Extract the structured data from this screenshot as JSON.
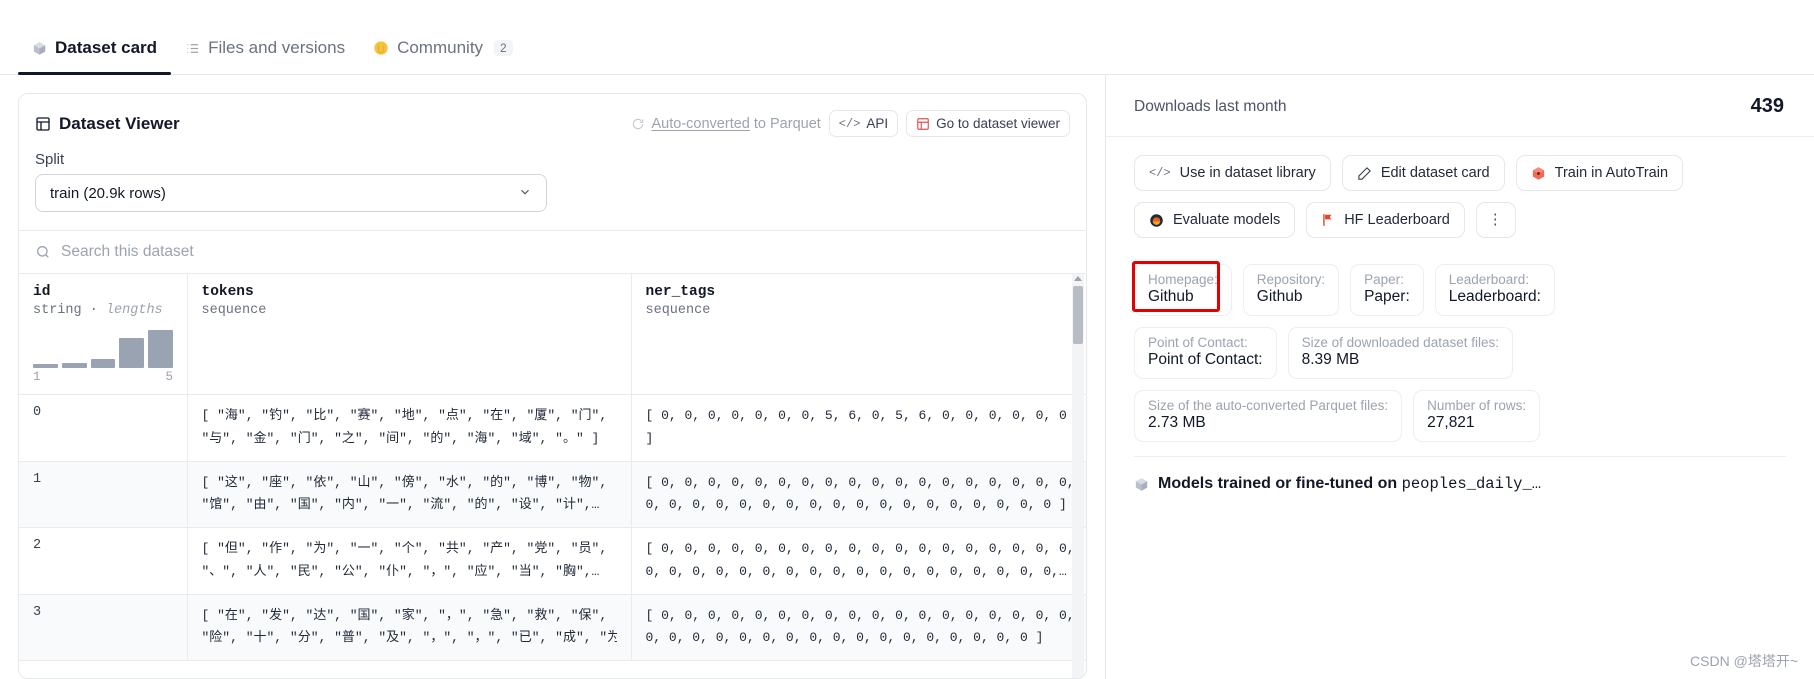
{
  "tabs": [
    {
      "label": "Dataset card",
      "icon": "cube-icon",
      "active": true,
      "badge": ""
    },
    {
      "label": "Files and versions",
      "icon": "files-icon",
      "active": false,
      "badge": ""
    },
    {
      "label": "Community",
      "icon": "wave-hand-icon",
      "active": false,
      "badge": "2"
    }
  ],
  "viewer": {
    "title": "Dataset Viewer",
    "title_icon": "grid-icon",
    "parquet_link": "Auto-converted to Parquet",
    "parquet_icon": "refresh-icon",
    "api_button": "API",
    "api_icon": "code-icon",
    "goto_button": "Go to dataset viewer",
    "goto_icon": "table-icon",
    "split_label": "Split",
    "split_value": "train (20.9k rows)",
    "split_chevron": "chevron-down-icon",
    "search_placeholder": "Search this dataset",
    "search_icon": "search-icon"
  },
  "table": {
    "columns": [
      {
        "name": "id",
        "type_prefix": "string",
        "type_sep": "·",
        "type_em": "lengths",
        "histogram": {
          "values": [
            4,
            5,
            9,
            30,
            38
          ],
          "min_label": "1",
          "max_label": "5"
        }
      },
      {
        "name": "tokens",
        "type_prefix": "sequence",
        "type_sep": "",
        "type_em": ""
      },
      {
        "name": "ner_tags",
        "type_prefix": "sequence",
        "type_sep": "",
        "type_em": ""
      }
    ],
    "rows": [
      {
        "id": "0",
        "tokens_line1": "[ \"海\", \"钓\", \"比\", \"赛\", \"地\", \"点\", \"在\", \"厦\", \"门\",",
        "tokens_line2": "\"与\", \"金\", \"门\", \"之\", \"间\", \"的\", \"海\", \"域\", \"。\" ]",
        "ner_line1": "[ 0, 0, 0, 0, 0, 0, 0, 5, 6, 0, 5, 6, 0, 0, 0, 0, 0, 0",
        "ner_line2": "]"
      },
      {
        "id": "1",
        "tokens_line1": "[ \"这\", \"座\", \"依\", \"山\", \"傍\", \"水\", \"的\", \"博\", \"物\",",
        "tokens_line2": "\"馆\", \"由\", \"国\", \"内\", \"一\", \"流\", \"的\", \"设\", \"计\",…",
        "ner_line1": "[ 0, 0, 0, 0, 0, 0, 0, 0, 0, 0, 0, 0, 0, 0, 0, 0, 0, 0,",
        "ner_line2": "0, 0, 0, 0, 0, 0, 0, 0, 0, 0, 0, 0, 0, 0, 0, 0, 0, 0 ]"
      },
      {
        "id": "2",
        "tokens_line1": "[ \"但\", \"作\", \"为\", \"一\", \"个\", \"共\", \"产\", \"党\", \"员\",",
        "tokens_line2": "\"、\", \"人\", \"民\", \"公\", \"仆\", \"，\", \"应\", \"当\", \"胸\",…",
        "ner_line1": "[ 0, 0, 0, 0, 0, 0, 0, 0, 0, 0, 0, 0, 0, 0, 0, 0, 0, 0,",
        "ner_line2": "0, 0, 0, 0, 0, 0, 0, 0, 0, 0, 0, 0, 0, 0, 0, 0, 0, 0,…"
      },
      {
        "id": "3",
        "tokens_line1": "[ \"在\", \"发\", \"达\", \"国\", \"家\", \"，\", \"急\", \"救\", \"保\",",
        "tokens_line2": "\"险\", \"十\", \"分\", \"普\", \"及\", \"，\", \"，\", \"已\", \"成\", \"为\",…",
        "ner_line1": "[ 0, 0, 0, 0, 0, 0, 0, 0, 0, 0, 0, 0, 0, 0, 0, 0, 0, 0,",
        "ner_line2": "0, 0, 0, 0, 0, 0, 0, 0, 0, 0, 0, 0, 0, 0, 0, 0, 0 ]"
      }
    ]
  },
  "sidebar": {
    "downloads_label": "Downloads last month",
    "downloads_value": "439",
    "buttons": [
      {
        "label": "Use in dataset library",
        "icon": "code-icon"
      },
      {
        "label": "Edit dataset card",
        "icon": "pencil-icon"
      },
      {
        "label": "Train in AutoTrain",
        "icon": "autotrain-cube-icon"
      },
      {
        "label": "Evaluate models",
        "icon": "evaluate-circle-icon"
      },
      {
        "label": "HF Leaderboard",
        "icon": "flag-icon"
      }
    ],
    "overflow_button": "⋮",
    "meta_rows": [
      [
        {
          "key": "Homepage:",
          "value": "Github",
          "highlighted": true
        },
        {
          "key": "Repository:",
          "value": "Github",
          "highlighted": false
        },
        {
          "key": "Paper:",
          "value": "Paper:",
          "highlighted": false
        },
        {
          "key": "Leaderboard:",
          "value": "Leaderboard:",
          "highlighted": false
        }
      ],
      [
        {
          "key": "Point of Contact:",
          "value": "Point of Contact:",
          "highlighted": false
        },
        {
          "key": "Size of downloaded dataset files:",
          "value": "8.39 MB",
          "highlighted": false
        }
      ],
      [
        {
          "key": "Size of the auto-converted Parquet files:",
          "value": "2.73 MB",
          "highlighted": false
        },
        {
          "key": "Number of rows:",
          "value": "27,821",
          "highlighted": false
        }
      ]
    ],
    "models_icon": "cube-icon",
    "models_prefix": "Models trained or fine-tuned on ",
    "models_dataset": "peoples_daily_…"
  },
  "watermark": "CSDN @塔塔开~",
  "colors": {
    "accent_highlight": "#e60000",
    "border": "#e5e7eb",
    "muted_text": "#9ca3af",
    "hist_bar": "#9aa3b2"
  }
}
